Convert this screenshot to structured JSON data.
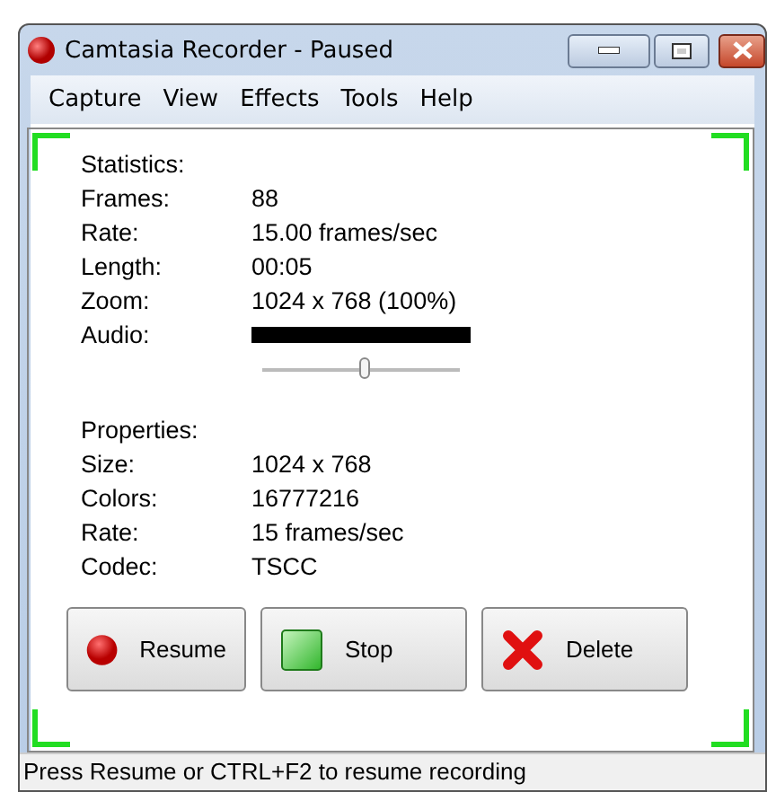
{
  "window": {
    "title": "Camtasia Recorder - Paused"
  },
  "menu": [
    "Capture",
    "View",
    "Effects",
    "Tools",
    "Help"
  ],
  "statistics": {
    "heading": "Statistics:",
    "rows": [
      {
        "label": "Frames:",
        "value": "88"
      },
      {
        "label": "Rate:",
        "value": "15.00 frames/sec"
      },
      {
        "label": "Length:",
        "value": "00:05"
      },
      {
        "label": "Zoom:",
        "value": "1024 x 768 (100%)"
      }
    ],
    "audio": {
      "label": "Audio:",
      "meter": {
        "level": 1
      },
      "volume": {
        "level": 0.52
      }
    }
  },
  "properties": {
    "heading": "Properties:",
    "rows": [
      {
        "label": "Size:",
        "value": "1024 x 768"
      },
      {
        "label": "Colors:",
        "value": "16777216"
      },
      {
        "label": "Rate:",
        "value": "15 frames/sec"
      },
      {
        "label": "Codec:",
        "value": "TSCC"
      }
    ]
  },
  "buttons": [
    {
      "kind": "record",
      "label": "Resume"
    },
    {
      "kind": "stop",
      "label": "Stop"
    },
    {
      "kind": "delete",
      "label": "Delete"
    }
  ],
  "status_bar": "Press Resume or CTRL+F2 to resume recording"
}
